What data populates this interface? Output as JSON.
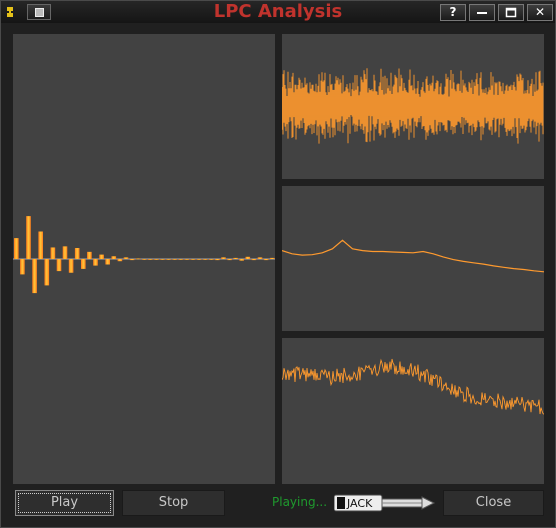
{
  "window": {
    "title": "LPC Analysis",
    "title_color": "#c0332d",
    "help_label": "?",
    "close_label": "✕"
  },
  "accent": "#ff9a2e",
  "panel_bg": "#424242",
  "footer": {
    "play_label": "Play",
    "stop_label": "Stop",
    "status_text": "Playing...",
    "status_color": "#1f9a2e",
    "jack_logo_text": "JACK",
    "close_label": "Close"
  },
  "chart_data": [
    {
      "name": "lpc-coefficients",
      "type": "bar",
      "values": [
        0.38,
        -0.28,
        0.78,
        -0.62,
        0.5,
        -0.48,
        0.21,
        -0.22,
        0.23,
        -0.25,
        0.2,
        -0.18,
        0.13,
        -0.12,
        0.08,
        -0.1,
        0.05,
        -0.04,
        0.03,
        -0.02,
        0.01,
        0.0,
        0.0,
        0.0,
        0.0,
        0.0,
        0.0,
        0.0,
        0.0,
        0.0,
        0.0,
        0.0,
        0.0,
        -0.02,
        0.03,
        -0.02,
        0.02,
        -0.03,
        0.04,
        -0.02,
        0.03,
        -0.02,
        0.02
      ],
      "ylim": [
        -1,
        1
      ]
    },
    {
      "name": "signal-waveform",
      "type": "line",
      "description": "noisy audio waveform",
      "ylim": [
        -1,
        1
      ]
    },
    {
      "name": "lpc-envelope",
      "type": "line",
      "values": [
        0.62,
        0.55,
        0.52,
        0.53,
        0.57,
        0.66,
        0.85,
        0.66,
        0.62,
        0.6,
        0.6,
        0.59,
        0.58,
        0.57,
        0.6,
        0.55,
        0.48,
        0.42,
        0.38,
        0.35,
        0.32,
        0.28,
        0.25,
        0.22,
        0.2,
        0.17,
        0.15
      ],
      "ylim": [
        -1,
        1
      ]
    },
    {
      "name": "spectrum",
      "type": "line",
      "description": "noisy magnitude spectrum with formant peak near middle",
      "ylim": [
        -1,
        1
      ]
    }
  ]
}
